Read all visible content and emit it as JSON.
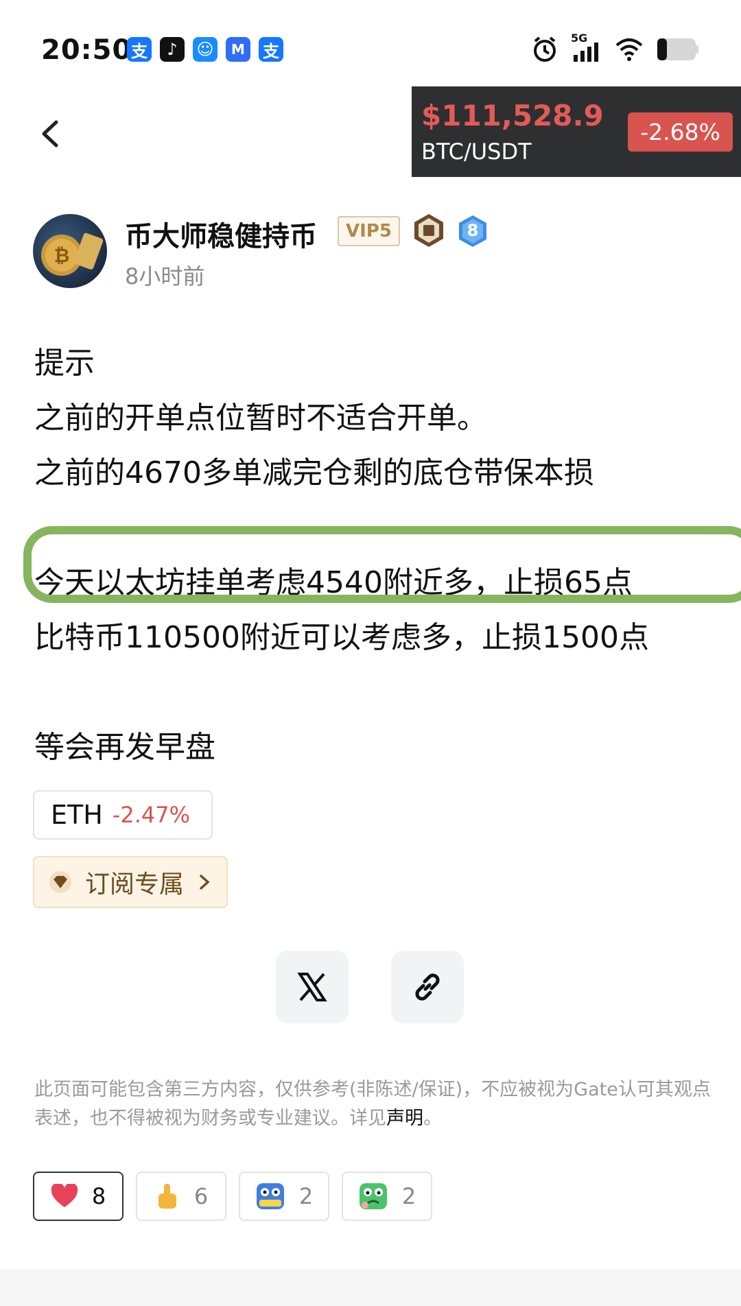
{
  "status_bar": {
    "time": "20:50",
    "network": "5G",
    "app_icons": [
      {
        "name": "alipay-icon",
        "glyph": "支",
        "color": "#1677ff"
      },
      {
        "name": "tiktok-icon",
        "glyph": "♪",
        "color": "#111111"
      },
      {
        "name": "chat-app-icon",
        "glyph": "☺",
        "color": "#1a8cff"
      },
      {
        "name": "m-app-icon",
        "glyph": "M",
        "color": "#2f6df6"
      },
      {
        "name": "alipay-icon-2",
        "glyph": "支",
        "color": "#1677ff"
      }
    ]
  },
  "price_banner": {
    "price": "$111,528.9",
    "pair": "BTC/USDT",
    "change": "-2.68%"
  },
  "author": {
    "name": "币大师稳健持币",
    "vip": "VIP5",
    "level": "8",
    "time": "8小时前"
  },
  "content": {
    "lines": [
      "提示",
      "之前的开单点位暂时不适合开单。",
      "之前的4670多单减完仓剩的底仓带保本损",
      "",
      "今天以太坊挂单考虑4540附近多，止损65点",
      "比特币110500附近可以考虑多，止损1500点",
      "",
      "等会再发早盘"
    ]
  },
  "tags": {
    "coin_symbol": "ETH",
    "coin_change": "-2.47%",
    "subscribe_label": "订阅专属"
  },
  "disclaimer": {
    "text": "此页面可能包含第三方内容，仅供参考(非陈述/保证)，不应被视为Gate认可其观点表述，也不得被视为财务或专业建议。详见",
    "link": "声明",
    "end": "。"
  },
  "reactions": [
    {
      "name": "heart",
      "count": "8"
    },
    {
      "name": "thumbs-up",
      "count": "6"
    },
    {
      "name": "hodl",
      "count": "2"
    },
    {
      "name": "sick-face",
      "count": "2"
    }
  ],
  "colors": {
    "negative": "#d9534f",
    "highlight_border": "#86b45f",
    "banner_bg": "#2e2f31"
  }
}
